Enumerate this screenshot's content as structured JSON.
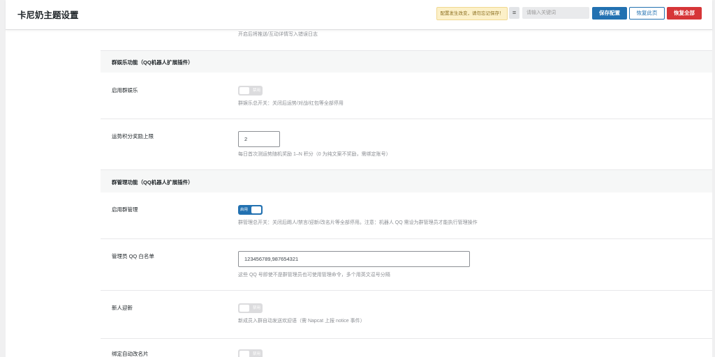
{
  "header": {
    "title": "卡尼奶主题设置",
    "notice": "配置发生改变，请勿忘记保存！",
    "menu_icon": "≡",
    "search_placeholder": "请输入关键词",
    "save_label": "保存配置",
    "restore_page_label": "恢复此页",
    "restore_all_label": "恢复全部"
  },
  "top_desc": "开启后将推送/互动详情写入错误日志",
  "sections": [
    {
      "title": "群娱乐功能（QQ机器人扩展插件）",
      "fields": [
        {
          "label": "启用群娱乐",
          "type": "toggle",
          "state": "off",
          "toggle_text": "禁用",
          "desc": "群娱乐总开关：关闭后运势/对战/红包等全部停用"
        },
        {
          "label": "运势积分奖励上限",
          "type": "number",
          "value": "2",
          "desc": "每日首次测运势随机奖励 1–N 积分（0 为纯文案不奖励，需绑定账号）"
        }
      ]
    },
    {
      "title": "群管理功能（QQ机器人扩展插件）",
      "fields": [
        {
          "label": "启用群管理",
          "type": "toggle",
          "state": "on",
          "toggle_text": "启用",
          "desc": "群管理总开关：关闭后踢人/禁言/迎新/改名片等全部停用。注意：机器人 QQ 需设为群管理员才能执行管理操作"
        },
        {
          "label": "管理员 QQ 白名单",
          "type": "text",
          "value": "123456789,987654321",
          "desc": "这些 QQ 号即使不是群管理员也可使用管理命令，多个用英文逗号分隔"
        },
        {
          "label": "新人迎新",
          "type": "toggle",
          "state": "off",
          "toggle_text": "禁用",
          "desc": "新成员入群自动发送欢迎语（需 Napcat 上报 notice 事件）"
        },
        {
          "label": "绑定自动改名片",
          "type": "toggle",
          "state": "off",
          "toggle_text": "禁用"
        }
      ]
    }
  ],
  "colors": {
    "primary": "#2271b1",
    "danger": "#d63638",
    "notice_bg": "#fcf0c8"
  }
}
